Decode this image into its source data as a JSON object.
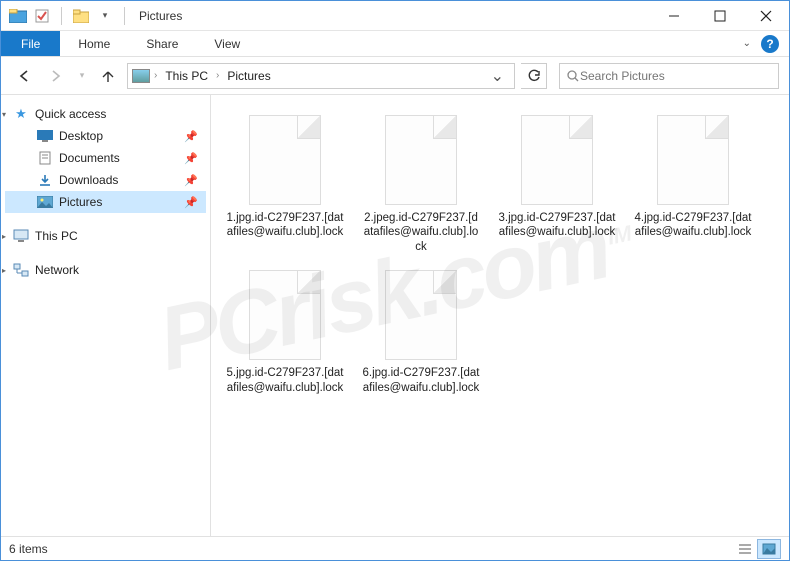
{
  "titlebar": {
    "title": "Pictures"
  },
  "ribbon": {
    "file": "File",
    "tabs": [
      "Home",
      "Share",
      "View"
    ]
  },
  "nav": {
    "breadcrumb": [
      "This PC",
      "Pictures"
    ],
    "search_placeholder": "Search Pictures"
  },
  "sidebar": {
    "quick_access": "Quick access",
    "items": [
      {
        "label": "Desktop",
        "icon": "desktop"
      },
      {
        "label": "Documents",
        "icon": "documents"
      },
      {
        "label": "Downloads",
        "icon": "downloads"
      },
      {
        "label": "Pictures",
        "icon": "pictures",
        "selected": true
      }
    ],
    "this_pc": "This PC",
    "network": "Network"
  },
  "files": [
    {
      "name": "1.jpg.id-C279F237.[datafiles@waifu.club].lock"
    },
    {
      "name": "2.jpeg.id-C279F237.[datafiles@waifu.club].lock"
    },
    {
      "name": "3.jpg.id-C279F237.[datafiles@waifu.club].lock"
    },
    {
      "name": "4.jpg.id-C279F237.[datafiles@waifu.club].lock"
    },
    {
      "name": "5.jpg.id-C279F237.[datafiles@waifu.club].lock"
    },
    {
      "name": "6.jpg.id-C279F237.[datafiles@waifu.club].lock"
    }
  ],
  "status": {
    "count_text": "6 items"
  },
  "watermark": {
    "text": "PCrisk.com",
    "tm": "TM"
  }
}
